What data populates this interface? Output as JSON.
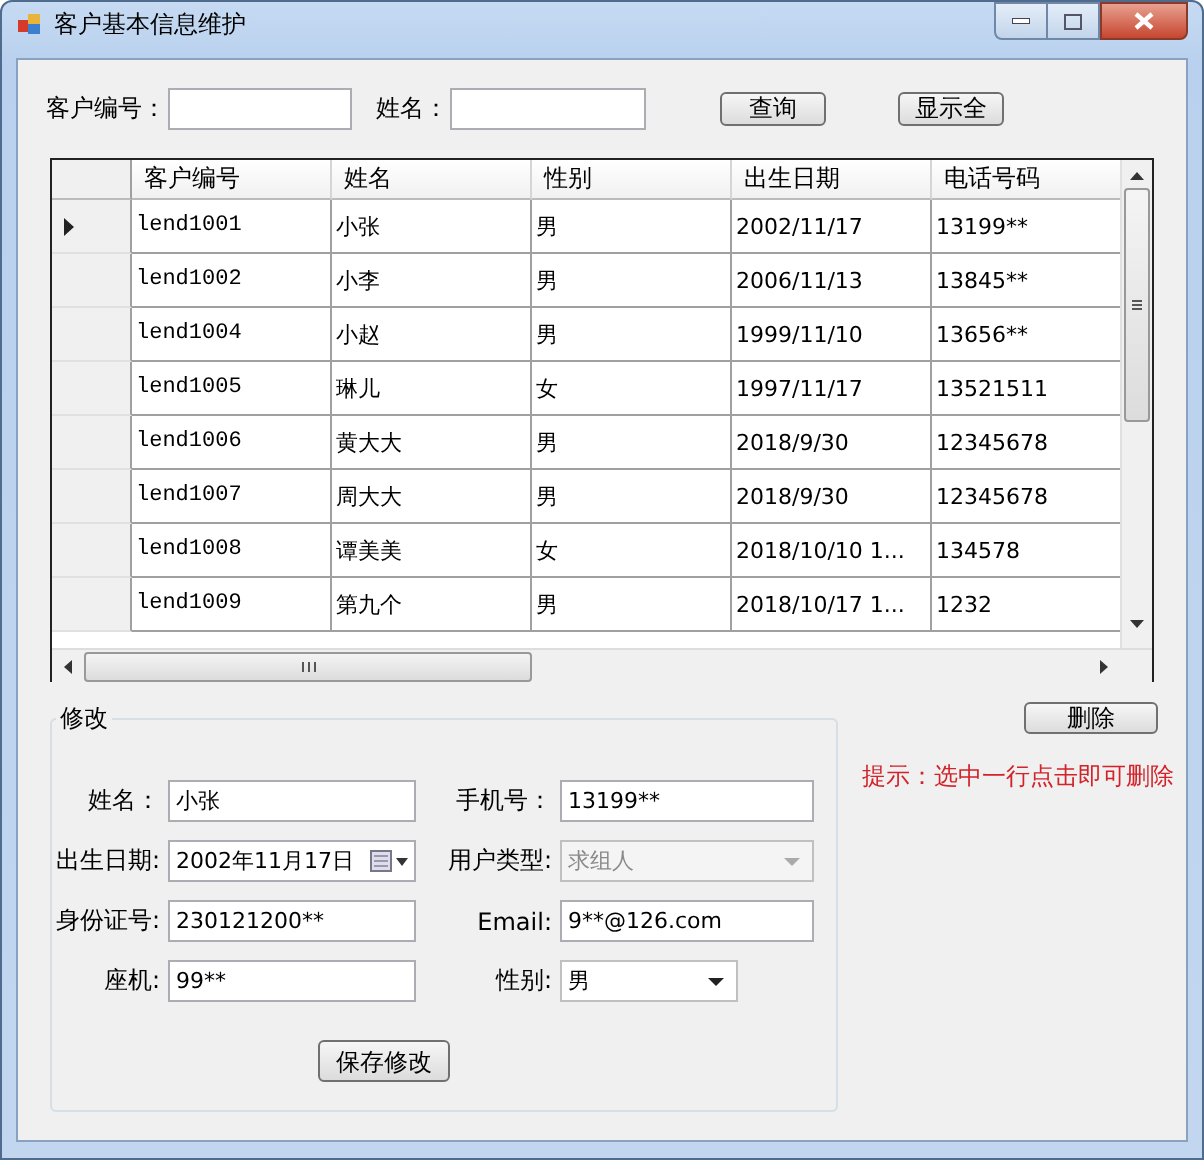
{
  "window": {
    "title": "客户基本信息维护"
  },
  "search": {
    "fields": [
      {
        "label": "客户编号："
      },
      {
        "label": "姓名："
      }
    ],
    "buttons": [
      "查询",
      "显示全"
    ]
  },
  "table": {
    "columns": [
      "客户编号",
      "姓名",
      "性别",
      "出生日期",
      "电话号码"
    ],
    "rows": [
      {
        "selected": true,
        "cells": [
          "lend1001",
          "小张",
          "男",
          "2002/11/17",
          "13199**"
        ]
      },
      {
        "selected": false,
        "cells": [
          "lend1002",
          "小李",
          "男",
          "2006/11/13",
          "13845**"
        ]
      },
      {
        "selected": false,
        "cells": [
          "lend1004",
          "小赵",
          "男",
          "1999/11/10",
          "13656**"
        ]
      },
      {
        "selected": false,
        "cells": [
          "lend1005",
          "琳儿",
          "女",
          "1997/11/17",
          "13521511"
        ]
      },
      {
        "selected": false,
        "cells": [
          "lend1006",
          "黄大大",
          "男",
          "2018/9/30",
          "12345678"
        ]
      },
      {
        "selected": false,
        "cells": [
          "lend1007",
          "周大大",
          "男",
          "2018/9/30",
          "12345678"
        ]
      },
      {
        "selected": false,
        "cells": [
          "lend1008",
          "谭美美",
          "女",
          "2018/10/10 1...",
          "134578"
        ]
      },
      {
        "selected": false,
        "cells": [
          "lend1009",
          "第九个",
          "男",
          "2018/10/17 1...",
          "1232"
        ]
      }
    ]
  },
  "edit": {
    "title": "修改",
    "fields": [
      {
        "kind": "text",
        "label": "姓名：",
        "value": "小张"
      },
      {
        "kind": "text",
        "label": "手机号：",
        "value": "13199**"
      },
      {
        "kind": "date",
        "label": "出生日期:",
        "value": "2002年11月17日"
      },
      {
        "kind": "combo",
        "label": "用户类型:",
        "value": "求组人",
        "disabled": true
      },
      {
        "kind": "text",
        "label": "身份证号:",
        "value": "230121200**"
      },
      {
        "kind": "text",
        "label": "Email:",
        "value": "9**@126.com"
      },
      {
        "kind": "text",
        "label": "座机:",
        "value": "99**"
      },
      {
        "kind": "combo",
        "label": "性别:",
        "value": "男",
        "disabled": false
      }
    ],
    "save_button": "保存修改"
  },
  "delete_button": "删除",
  "hint": "提示：选中一行点击即可删除"
}
